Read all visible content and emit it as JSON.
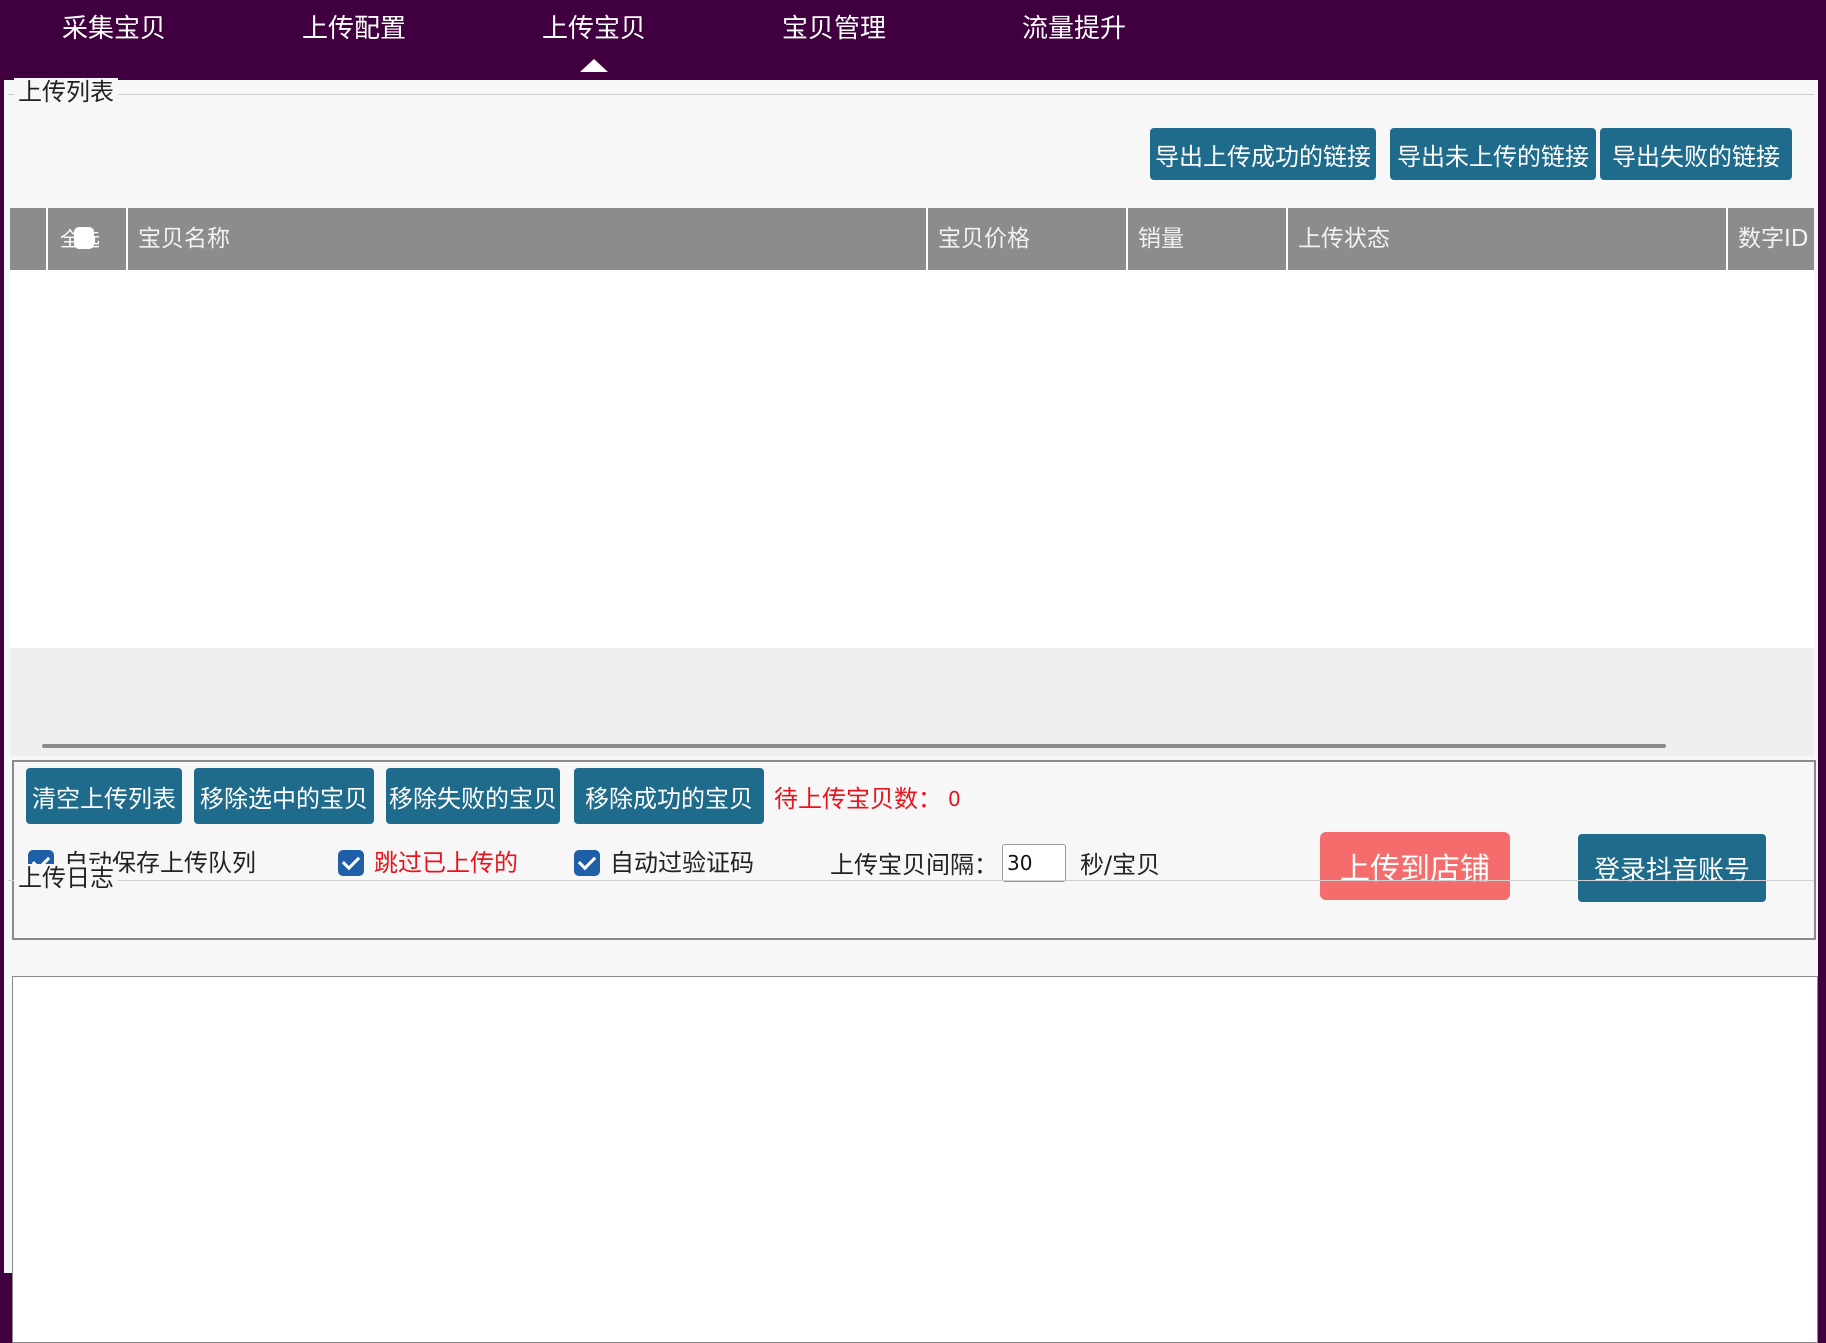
{
  "nav": {
    "tabs": [
      {
        "label": "采集宝贝"
      },
      {
        "label": "上传配置"
      },
      {
        "label": "上传宝贝"
      },
      {
        "label": "宝贝管理"
      },
      {
        "label": "流量提升"
      }
    ],
    "active_index": 2
  },
  "upload_list": {
    "title": "上传列表",
    "export_buttons": {
      "success": "导出上传成功的链接",
      "not_uploaded": "导出未上传的链接",
      "failed": "导出失败的链接"
    },
    "columns": {
      "select_all": "全选",
      "name": "宝贝名称",
      "price": "宝贝价格",
      "sales": "销量",
      "status": "上传状态",
      "numeric_id": "数字ID"
    },
    "rows": []
  },
  "controls": {
    "clear_list": "清空上传列表",
    "remove_selected": "移除选中的宝贝",
    "remove_failed": "移除失败的宝贝",
    "remove_success": "移除成功的宝贝",
    "pending_label": "待上传宝贝数：",
    "pending_count": "0",
    "auto_save_queue": "自动保存上传队列",
    "skip_uploaded": "跳过已上传的",
    "auto_captcha": "自动过验证码",
    "interval_label": "上传宝贝间隔：",
    "interval_value": "30",
    "interval_unit": "秒/宝贝",
    "upload_to_store": "上传到店铺",
    "login_douyin": "登录抖音账号"
  },
  "log": {
    "title": "上传日志",
    "content": ""
  },
  "colors": {
    "nav_bg": "#40003f",
    "button_blue": "#1e6b8c",
    "upload_button": "#f56c6c",
    "warning_red": "#e8141c",
    "checkbox_blue": "#1e5fa8",
    "table_header": "#8c8c8c"
  }
}
